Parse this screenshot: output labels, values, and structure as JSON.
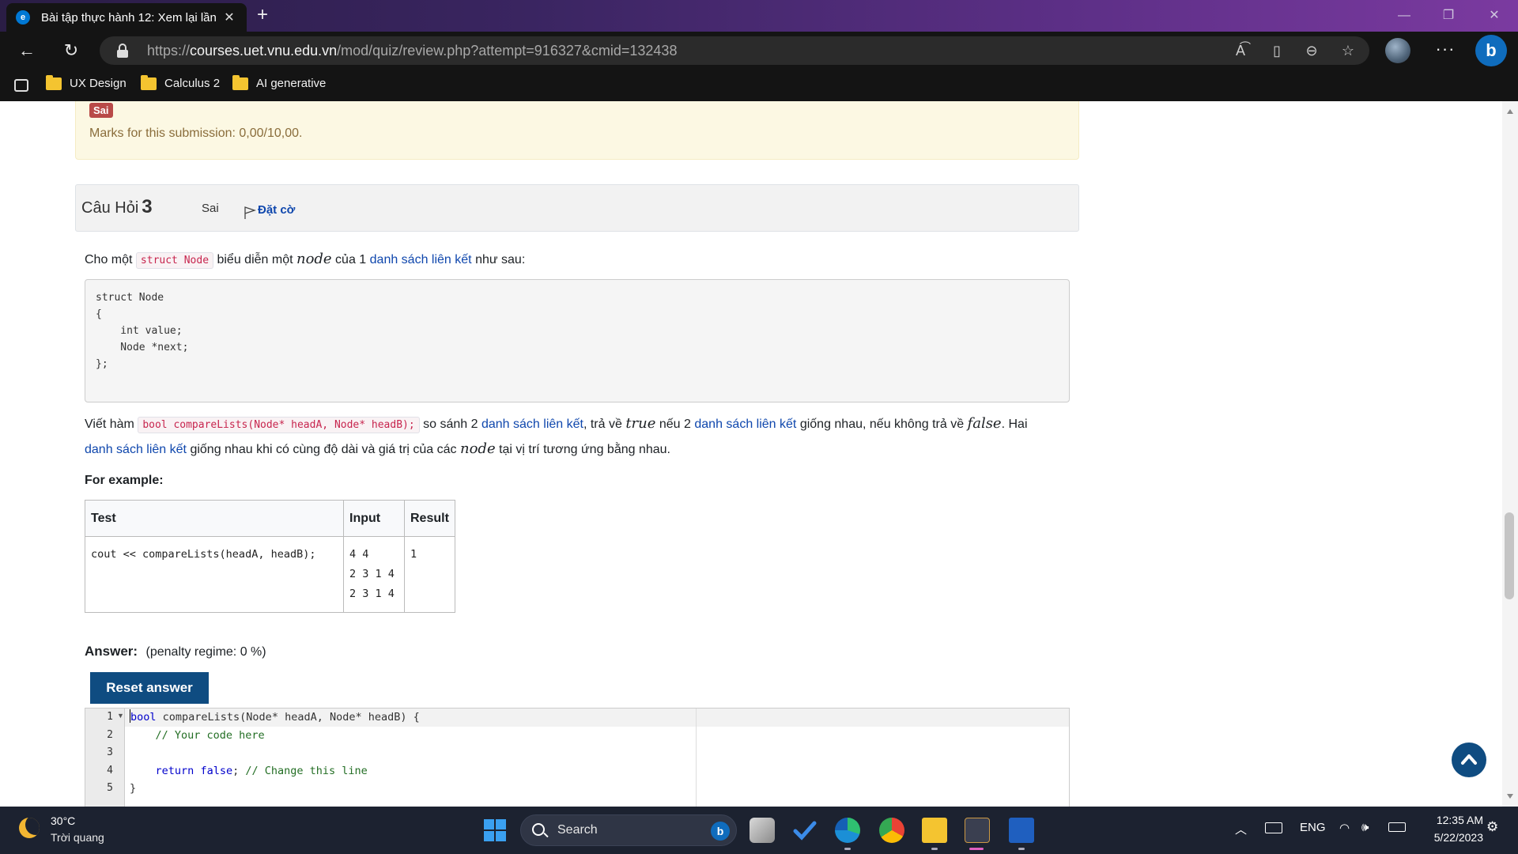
{
  "browser": {
    "tab_title": "Bài tập thực hành 12: Xem lại lần",
    "url_prefix": "https://",
    "url_host": "courses.uet.vnu.edu.vn",
    "url_path": "/mod/quiz/review.php?attempt=916327&cmid=132438",
    "bookmarks": [
      "UX Design",
      "Calculus 2",
      "AI generative"
    ]
  },
  "feedback": {
    "badge": "Sai",
    "marks": "Marks for this submission: 0,00/10,00."
  },
  "question": {
    "title_prefix": "Câu Hỏi",
    "number": "3",
    "state": "Sai",
    "flag_label": "Đặt cờ",
    "intro": {
      "t1": "Cho một",
      "code": "struct Node",
      "t2": "biểu diễn một",
      "math": "node",
      "t3": "của 1",
      "link": "danh sách liên kết",
      "t4": "như sau:"
    },
    "struct_lines": [
      "struct Node",
      "{",
      "    int value;",
      "    Node *next;",
      "};"
    ],
    "desc": {
      "t1": "Viết hàm",
      "code": "bool compareLists(Node* headA, Node* headB);",
      "t2": "so sánh 2",
      "link1": "danh sách liên kết",
      "t3": ", trả về",
      "math_true": "true",
      "t4": "nếu 2",
      "link2": "danh sách liên kết",
      "t5": "giống nhau, nếu không trả về",
      "math_false": "false",
      "t6": ". Hai",
      "link3": "danh sách liên kết",
      "t7": "giống nhau khi có cùng độ dài và giá trị của các",
      "math_node": "node",
      "t8": "tại vị trí tương ứng bằng nhau."
    },
    "example_heading": "For example:",
    "example_table": {
      "headers": [
        "Test",
        "Input",
        "Result"
      ],
      "test": "cout << compareLists(headA, headB);",
      "input_lines": [
        "4 4",
        "2 3 1 4",
        "2 3 1 4"
      ],
      "result": "1"
    },
    "answer_label": "Answer:",
    "penalty": "(penalty regime: 0 %)",
    "reset_label": "Reset answer",
    "editor": {
      "line_numbers": [
        "1",
        "2",
        "3",
        "4",
        "5"
      ],
      "l1_kw": "bool",
      "l1_rest": " compareLists(Node* headA, Node* headB) {",
      "l2_comment": "    // Your code here",
      "l4_indent": "    ",
      "l4_kw1": "return",
      "l4_mid": " ",
      "l4_kw2": "false",
      "l4_semi": "; ",
      "l4_comment": "// Change this line",
      "l5": "}"
    }
  },
  "taskbar": {
    "temperature": "30°C",
    "weather": "Trời quang",
    "search_label": "Search",
    "language": "ENG",
    "time": "12:35 AM",
    "date": "5/22/2023"
  }
}
